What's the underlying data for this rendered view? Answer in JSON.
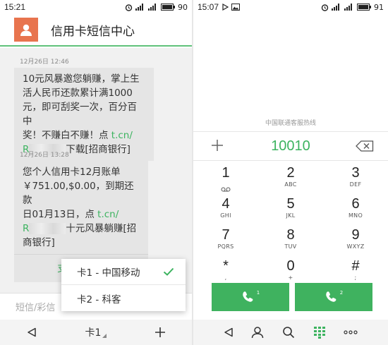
{
  "left": {
    "status": {
      "time": "15:21",
      "battery": "90"
    },
    "header": {
      "title": "信用卡短信中心",
      "avatar_icon": "person-icon",
      "accent": "#e8744e"
    },
    "messages": [
      {
        "timestamp": "12月26日 12:46",
        "lines": [
          "10元风暴邀您躺赚，掌上生",
          "活人民币还款累计满1000",
          "元，即可刮奖一次，百分百中",
          "奖！不赚白不赚！点 "
        ],
        "link1": "t.cn/",
        "link2": "R",
        "after_link": "下载[招商银行]"
      },
      {
        "timestamp": "12月26日 13:28",
        "lines": [
          "您个人信用卡12月账单",
          "￥751.00,$0.00，到期还款",
          "日01月13日，点 "
        ],
        "link1": "t.cn/",
        "link2": "R",
        "after_link": "十元风暴躺赚[招",
        "last_line": "商银行]",
        "action": "支付宝还款"
      }
    ],
    "input": {
      "placeholder": "短信/彩信"
    },
    "nav": {
      "back_icon": "back-triangle-icon",
      "sim_label": "卡1",
      "add_icon": "plus-icon"
    },
    "sim_menu": [
      {
        "label": "卡1 - 中国移动",
        "selected": true
      },
      {
        "label": "卡2 - 科客",
        "selected": false
      }
    ]
  },
  "right": {
    "status": {
      "time": "15:07",
      "battery": "91"
    },
    "hotline_label": "中国联通客服热线",
    "number": "10010",
    "keys": [
      {
        "digit": "1",
        "letters": ""
      },
      {
        "digit": "2",
        "letters": "ABC"
      },
      {
        "digit": "3",
        "letters": "DEF"
      },
      {
        "digit": "4",
        "letters": "GHI"
      },
      {
        "digit": "5",
        "letters": "JKL"
      },
      {
        "digit": "6",
        "letters": "MNO"
      },
      {
        "digit": "7",
        "letters": "PQRS"
      },
      {
        "digit": "8",
        "letters": "TUV"
      },
      {
        "digit": "9",
        "letters": "WXYZ"
      },
      {
        "digit": "*",
        "letters": ","
      },
      {
        "digit": "0",
        "letters": "+"
      },
      {
        "digit": "#",
        "letters": ";"
      }
    ],
    "call_buttons": [
      {
        "sim": "1"
      },
      {
        "sim": "2"
      }
    ],
    "accent": "#3fb25f"
  }
}
